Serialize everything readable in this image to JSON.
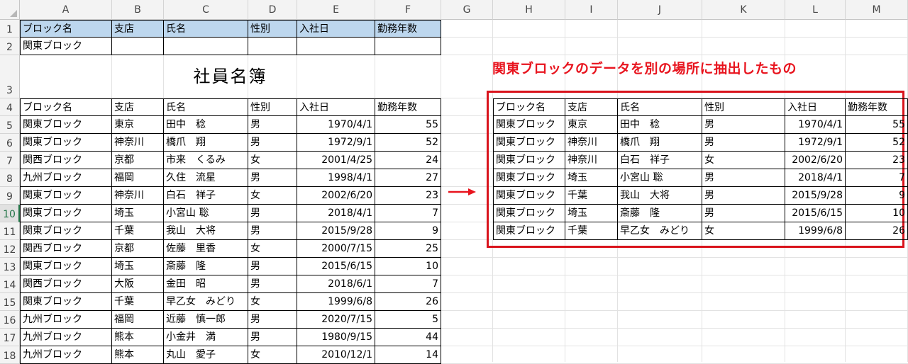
{
  "columns": [
    "A",
    "B",
    "C",
    "D",
    "E",
    "F",
    "G",
    "H",
    "I",
    "J",
    "K",
    "L",
    "M"
  ],
  "rows": [
    "1",
    "2",
    "3",
    "4",
    "5",
    "6",
    "7",
    "8",
    "9",
    "10",
    "11",
    "12",
    "13",
    "14",
    "15",
    "16",
    "17",
    "18"
  ],
  "header_row": {
    "block": "ブロック名",
    "branch": "支店",
    "name": "氏名",
    "gender": "性別",
    "hire_date": "入社日",
    "years": "勤務年数"
  },
  "criteria_value": "関東ブロック",
  "title": "社員名簿",
  "table_header": {
    "block": "ブロック名",
    "branch": "支店",
    "name": "氏名",
    "gender": "性別",
    "hire_date": "入社日",
    "years": "勤務年数"
  },
  "table_rows": [
    {
      "block": "関東ブロック",
      "branch": "東京",
      "name": "田中　稔",
      "gender": "男",
      "hire_date": "1970/4/1",
      "years": "55"
    },
    {
      "block": "関東ブロック",
      "branch": "神奈川",
      "name": "橋爪　翔",
      "gender": "男",
      "hire_date": "1972/9/1",
      "years": "52"
    },
    {
      "block": "関西ブロック",
      "branch": "京都",
      "name": "市来　くるみ",
      "gender": "女",
      "hire_date": "2001/4/25",
      "years": "24"
    },
    {
      "block": "九州ブロック",
      "branch": "福岡",
      "name": "久住　流星",
      "gender": "男",
      "hire_date": "1998/4/1",
      "years": "27"
    },
    {
      "block": "関東ブロック",
      "branch": "神奈川",
      "name": "白石　祥子",
      "gender": "女",
      "hire_date": "2002/6/20",
      "years": "23"
    },
    {
      "block": "関東ブロック",
      "branch": "埼玉",
      "name": "小宮山 聡",
      "gender": "男",
      "hire_date": "2018/4/1",
      "years": "7"
    },
    {
      "block": "関東ブロック",
      "branch": "千葉",
      "name": "我山　大将",
      "gender": "男",
      "hire_date": "2015/9/28",
      "years": "9"
    },
    {
      "block": "関西ブロック",
      "branch": "京都",
      "name": "佐藤　里香",
      "gender": "女",
      "hire_date": "2000/7/15",
      "years": "25"
    },
    {
      "block": "関東ブロック",
      "branch": "埼玉",
      "name": "斎藤　隆",
      "gender": "男",
      "hire_date": "2015/6/15",
      "years": "10"
    },
    {
      "block": "関西ブロック",
      "branch": "大阪",
      "name": "金田　昭",
      "gender": "男",
      "hire_date": "2018/6/1",
      "years": "7"
    },
    {
      "block": "関東ブロック",
      "branch": "千葉",
      "name": "早乙女　みどり",
      "gender": "女",
      "hire_date": "1999/6/8",
      "years": "26"
    },
    {
      "block": "九州ブロック",
      "branch": "福岡",
      "name": "近藤　慎一郎",
      "gender": "男",
      "hire_date": "2020/7/15",
      "years": "5"
    },
    {
      "block": "九州ブロック",
      "branch": "熊本",
      "name": "小金井　満",
      "gender": "男",
      "hire_date": "1980/9/15",
      "years": "44"
    },
    {
      "block": "九州ブロック",
      "branch": "熊本",
      "name": "丸山　愛子",
      "gender": "女",
      "hire_date": "2010/12/1",
      "years": "14"
    }
  ],
  "callout_text": "関東ブロックのデータを別の場所に抽出したもの",
  "extract_header": {
    "block": "ブロック名",
    "branch": "支店",
    "name": "氏名",
    "gender": "性別",
    "hire_date": "入社日",
    "years": "勤務年数"
  },
  "extract_rows": [
    {
      "block": "関東ブロック",
      "branch": "東京",
      "name": "田中　稔",
      "gender": "男",
      "hire_date": "1970/4/1",
      "years": "55"
    },
    {
      "block": "関東ブロック",
      "branch": "神奈川",
      "name": "橋爪　翔",
      "gender": "男",
      "hire_date": "1972/9/1",
      "years": "52"
    },
    {
      "block": "関東ブロック",
      "branch": "神奈川",
      "name": "白石　祥子",
      "gender": "女",
      "hire_date": "2002/6/20",
      "years": "23"
    },
    {
      "block": "関東ブロック",
      "branch": "埼玉",
      "name": "小宮山 聡",
      "gender": "男",
      "hire_date": "2018/4/1",
      "years": "7"
    },
    {
      "block": "関東ブロック",
      "branch": "千葉",
      "name": "我山　大将",
      "gender": "男",
      "hire_date": "2015/9/28",
      "years": "9"
    },
    {
      "block": "関東ブロック",
      "branch": "埼玉",
      "name": "斎藤　隆",
      "gender": "男",
      "hire_date": "2015/6/15",
      "years": "10"
    },
    {
      "block": "関東ブロック",
      "branch": "千葉",
      "name": "早乙女　みどり",
      "gender": "女",
      "hire_date": "1999/6/8",
      "years": "26"
    }
  ],
  "colors": {
    "header_fill": "#bdd7ee",
    "accent_red": "#e8141e",
    "selected_row_text": "#217346"
  }
}
